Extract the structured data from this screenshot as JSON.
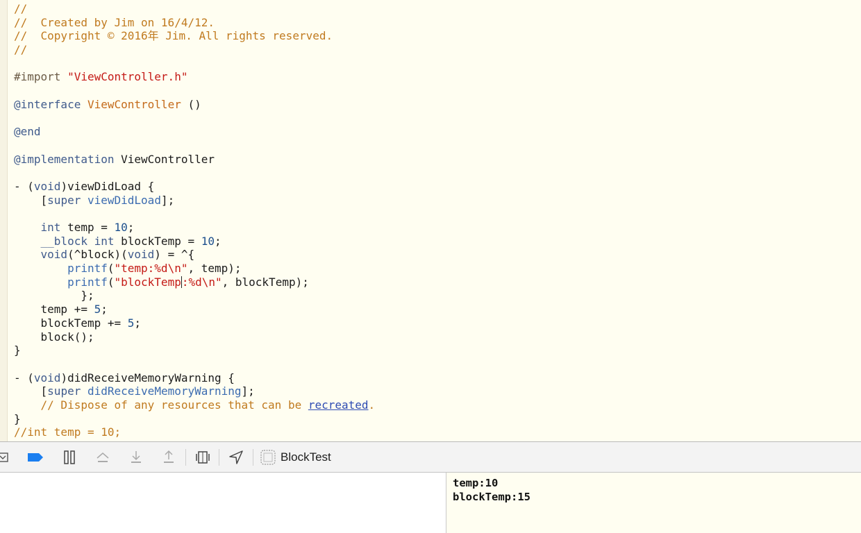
{
  "editor": {
    "lines": [
      {
        "t": [
          {
            "c": "c",
            "v": "//"
          }
        ]
      },
      {
        "t": [
          {
            "c": "c",
            "v": "//  Created by Jim on 16/4/12."
          }
        ]
      },
      {
        "t": [
          {
            "c": "c",
            "v": "//  Copyright © 2016年 Jim. All rights reserved."
          }
        ]
      },
      {
        "t": [
          {
            "c": "c",
            "v": "//"
          }
        ]
      },
      {
        "t": []
      },
      {
        "t": [
          {
            "c": "pp",
            "v": "#import "
          },
          {
            "c": "s",
            "v": "\"ViewController.h\""
          }
        ]
      },
      {
        "t": []
      },
      {
        "t": [
          {
            "c": "k",
            "v": "@interface"
          },
          {
            "c": "",
            "v": " "
          },
          {
            "c": "o",
            "v": "ViewController"
          },
          {
            "c": "",
            "v": " ()"
          }
        ]
      },
      {
        "t": []
      },
      {
        "t": [
          {
            "c": "k",
            "v": "@end"
          }
        ]
      },
      {
        "t": []
      },
      {
        "t": [
          {
            "c": "k",
            "v": "@implementation"
          },
          {
            "c": "",
            "v": " ViewController"
          }
        ]
      },
      {
        "t": []
      },
      {
        "t": [
          {
            "c": "",
            "v": "- ("
          },
          {
            "c": "k",
            "v": "void"
          },
          {
            "c": "",
            "v": ")viewDidLoad {"
          }
        ]
      },
      {
        "t": [
          {
            "c": "",
            "v": "    ["
          },
          {
            "c": "k",
            "v": "super"
          },
          {
            "c": "",
            "v": " "
          },
          {
            "c": "m",
            "v": "viewDidLoad"
          },
          {
            "c": "",
            "v": "];"
          }
        ]
      },
      {
        "t": []
      },
      {
        "t": [
          {
            "c": "",
            "v": "    "
          },
          {
            "c": "k",
            "v": "int"
          },
          {
            "c": "",
            "v": " temp = "
          },
          {
            "c": "n",
            "v": "10"
          },
          {
            "c": "",
            "v": ";"
          }
        ]
      },
      {
        "t": [
          {
            "c": "",
            "v": "    "
          },
          {
            "c": "k",
            "v": "__block int"
          },
          {
            "c": "",
            "v": " blockTemp = "
          },
          {
            "c": "n",
            "v": "10"
          },
          {
            "c": "",
            "v": ";"
          }
        ]
      },
      {
        "t": [
          {
            "c": "",
            "v": "    "
          },
          {
            "c": "k",
            "v": "void"
          },
          {
            "c": "",
            "v": "(^block)("
          },
          {
            "c": "k",
            "v": "void"
          },
          {
            "c": "",
            "v": ") = ^{"
          }
        ]
      },
      {
        "t": [
          {
            "c": "",
            "v": "        "
          },
          {
            "c": "m",
            "v": "printf"
          },
          {
            "c": "",
            "v": "("
          },
          {
            "c": "s",
            "v": "\"temp:%d\\n\""
          },
          {
            "c": "",
            "v": ", temp);"
          }
        ]
      },
      {
        "t": [
          {
            "c": "",
            "v": "        "
          },
          {
            "c": "m",
            "v": "printf"
          },
          {
            "c": "",
            "v": "("
          },
          {
            "c": "s",
            "v": "\"blockTemp"
          },
          {
            "c": "caret",
            "v": ""
          },
          {
            "c": "s",
            "v": ":%d\\n\""
          },
          {
            "c": "",
            "v": ", blockTemp);"
          }
        ]
      },
      {
        "t": [
          {
            "c": "",
            "v": "          };"
          }
        ]
      },
      {
        "t": [
          {
            "c": "",
            "v": "    temp += "
          },
          {
            "c": "n",
            "v": "5"
          },
          {
            "c": "",
            "v": ";"
          }
        ]
      },
      {
        "t": [
          {
            "c": "",
            "v": "    blockTemp += "
          },
          {
            "c": "n",
            "v": "5"
          },
          {
            "c": "",
            "v": ";"
          }
        ]
      },
      {
        "t": [
          {
            "c": "",
            "v": "    block();"
          }
        ]
      },
      {
        "t": [
          {
            "c": "",
            "v": "}"
          }
        ]
      },
      {
        "t": []
      },
      {
        "t": [
          {
            "c": "",
            "v": "- ("
          },
          {
            "c": "k",
            "v": "void"
          },
          {
            "c": "",
            "v": ")didReceiveMemoryWarning {"
          }
        ]
      },
      {
        "t": [
          {
            "c": "",
            "v": "    ["
          },
          {
            "c": "k",
            "v": "super"
          },
          {
            "c": "",
            "v": " "
          },
          {
            "c": "m",
            "v": "didReceiveMemoryWarning"
          },
          {
            "c": "",
            "v": "];"
          }
        ]
      },
      {
        "t": [
          {
            "c": "c",
            "v": "    // Dispose of any resources that can be "
          },
          {
            "c": "lnk",
            "v": "recreated"
          },
          {
            "c": "c",
            "v": "."
          }
        ]
      },
      {
        "t": [
          {
            "c": "",
            "v": "}"
          }
        ]
      },
      {
        "t": [
          {
            "c": "c",
            "v": "//int temp = 10;"
          }
        ]
      }
    ]
  },
  "debug_bar": {
    "target_label": "BlockTest",
    "accent": "#1a7ef0",
    "icons": [
      "console-toggle-icon",
      "breakpoints-icon",
      "pause-icon",
      "step-over-icon",
      "step-into-icon",
      "step-out-icon",
      "view-debugger-icon",
      "location-icon",
      "app-target-icon"
    ]
  },
  "console": {
    "output": "temp:10\nblockTemp:15"
  }
}
